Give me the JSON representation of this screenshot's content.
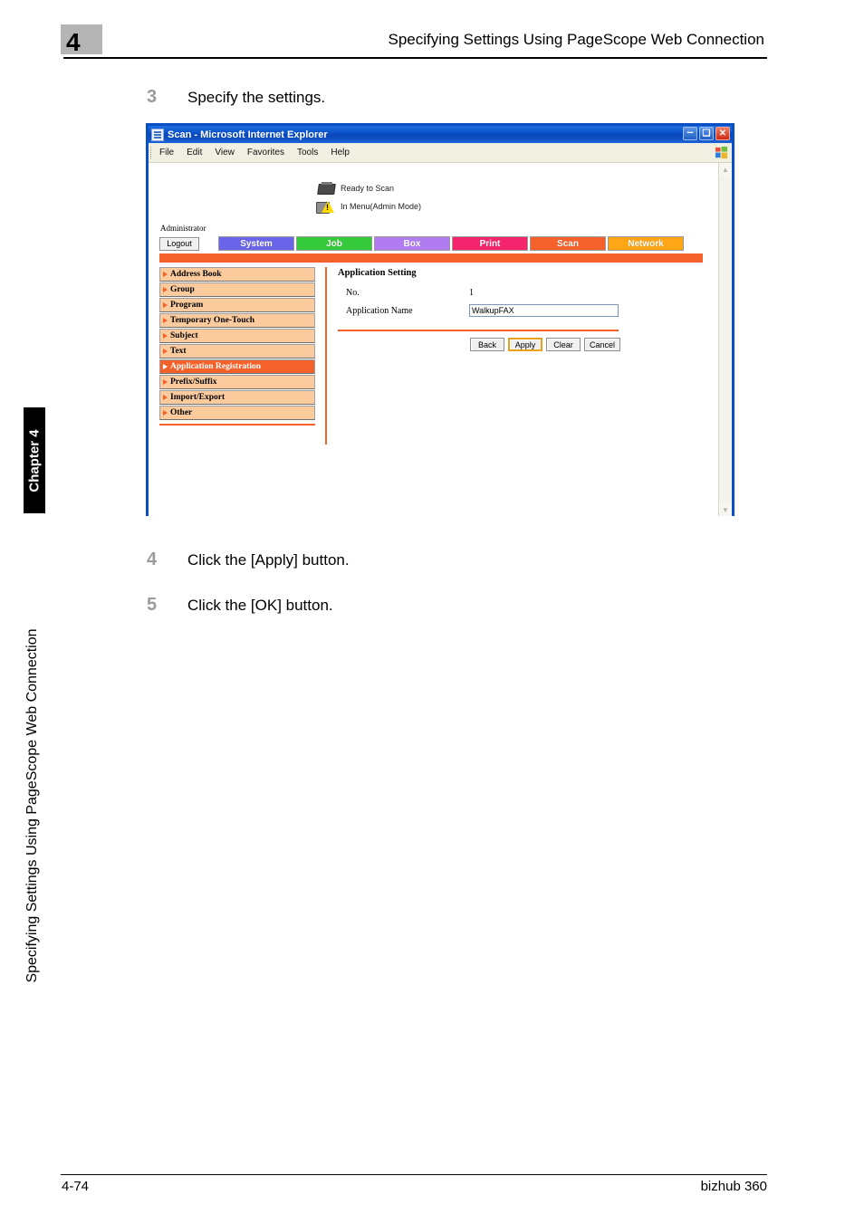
{
  "page": {
    "chapter_number": "4",
    "header_title": "Specifying Settings Using PageScope Web Connection",
    "chapter_tab_label": "Chapter 4",
    "side_running_head": "Specifying Settings Using PageScope Web Connection",
    "footer_page": "4-74",
    "footer_product": "bizhub 360"
  },
  "steps": [
    {
      "number": "3",
      "text": "Specify the settings."
    },
    {
      "number": "4",
      "text": "Click the [Apply] button."
    },
    {
      "number": "5",
      "text": "Click the [OK] button."
    }
  ],
  "browser": {
    "title": "Scan - Microsoft Internet Explorer",
    "window_buttons": {
      "minimize": "–",
      "maximize": "❑",
      "close": "✕"
    },
    "menu": [
      "File",
      "Edit",
      "View",
      "Favorites",
      "Tools",
      "Help"
    ],
    "scroll": {
      "up": "▲",
      "down": "▼"
    }
  },
  "webui": {
    "status": [
      {
        "icon": "printer-icon",
        "text": "Ready to Scan"
      },
      {
        "icon": "printer-warning-icon",
        "text": "In Menu(Admin Mode)"
      }
    ],
    "user_label": "Administrator",
    "logout_label": "Logout",
    "tabs": [
      {
        "label": "System",
        "color": "#6a64e8"
      },
      {
        "label": "Job",
        "color": "#35c93c"
      },
      {
        "label": "Box",
        "color": "#b07cf0"
      },
      {
        "label": "Print",
        "color": "#f5256d"
      },
      {
        "label": "Scan",
        "color": "#f4612a"
      },
      {
        "label": "Network",
        "color": "#ffa617"
      }
    ],
    "accent_color": "#f4612a",
    "side_menu": [
      {
        "label": "Address Book",
        "active": false
      },
      {
        "label": "Group",
        "active": false
      },
      {
        "label": "Program",
        "active": false
      },
      {
        "label": "Temporary One-Touch",
        "active": false
      },
      {
        "label": "Subject",
        "active": false
      },
      {
        "label": "Text",
        "active": false
      },
      {
        "label": "Application Registration",
        "active": true
      },
      {
        "label": "Prefix/Suffix",
        "active": false
      },
      {
        "label": "Import/Export",
        "active": false
      },
      {
        "label": "Other",
        "active": false
      }
    ],
    "form": {
      "title": "Application Setting",
      "rows": [
        {
          "label": "No.",
          "type": "text",
          "value": "1"
        },
        {
          "label": "Application Name",
          "type": "input",
          "value": "WalkupFAX"
        }
      ],
      "buttons": [
        {
          "label": "Back",
          "focused": false
        },
        {
          "label": "Apply",
          "focused": true
        },
        {
          "label": "Clear",
          "focused": false
        },
        {
          "label": "Cancel",
          "focused": false
        }
      ]
    }
  }
}
